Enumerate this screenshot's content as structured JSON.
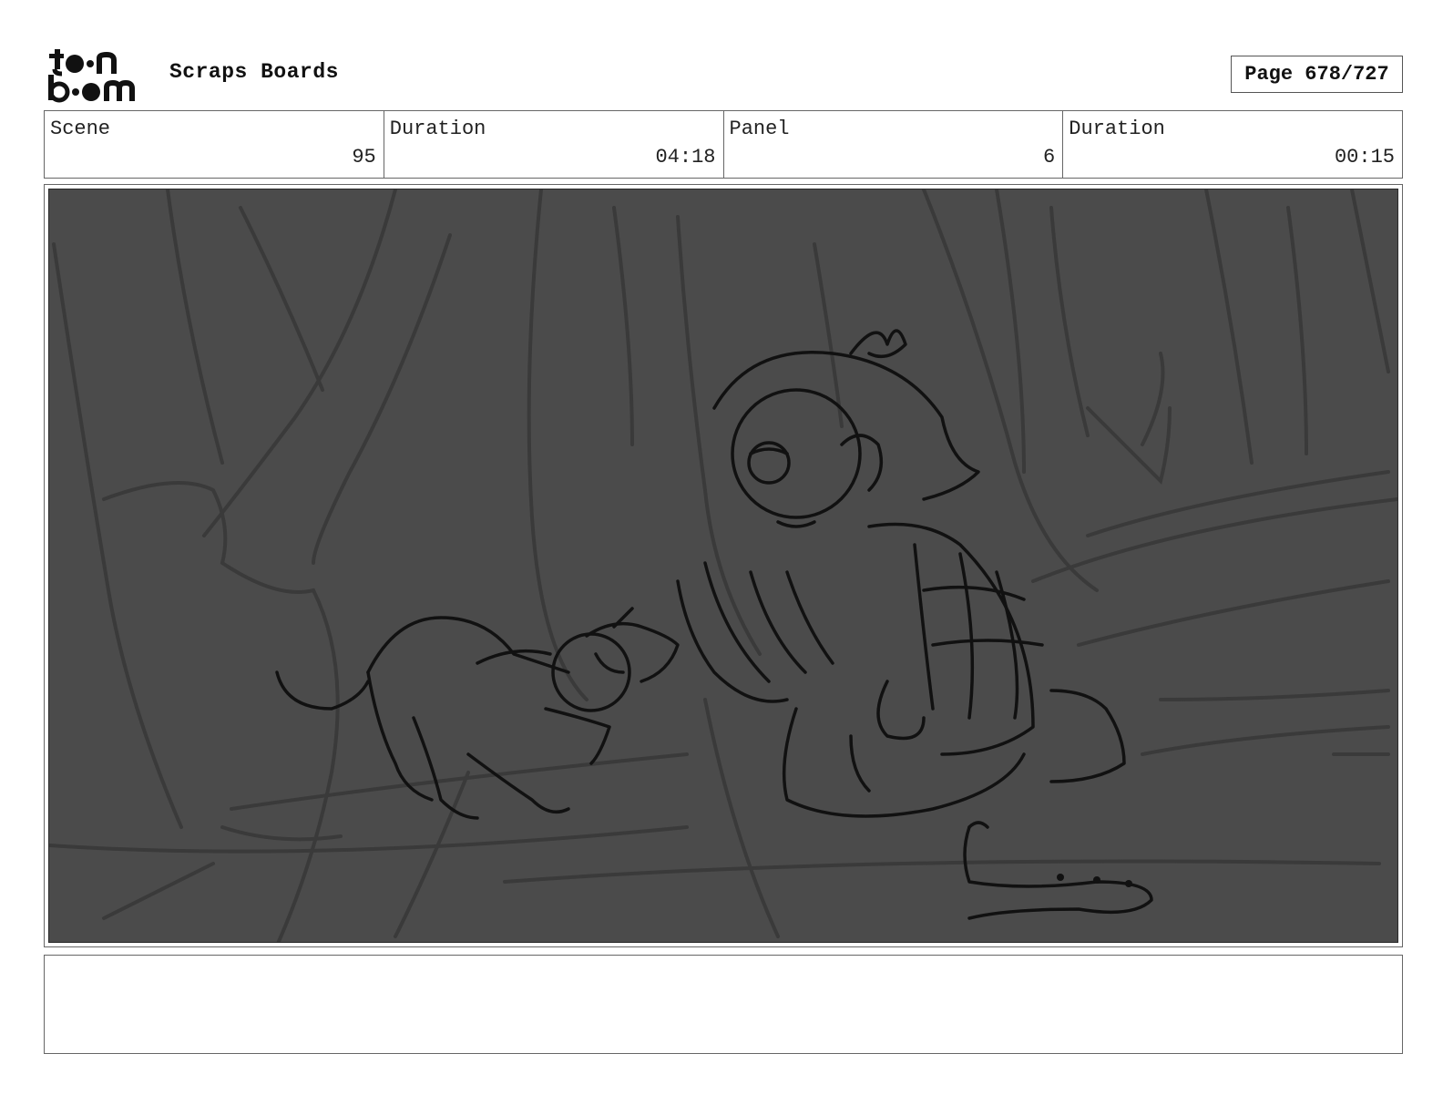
{
  "header": {
    "logo_text": "toon boom",
    "title": "Scraps Boards",
    "page_label": "Page 678/727"
  },
  "info": {
    "scene_label": "Scene",
    "scene_value": "95",
    "scene_duration_label": "Duration",
    "scene_duration_value": "04:18",
    "panel_label": "Panel",
    "panel_value": "6",
    "panel_duration_label": "Duration",
    "panel_duration_value": "00:15"
  },
  "panel": {
    "image_alt": "Storyboard sketch: a kneeling girl raises her hands toward a small dog in a forest, a collar lies on the ground",
    "background_color": "#4b4b4b"
  },
  "notes": {
    "text": ""
  }
}
